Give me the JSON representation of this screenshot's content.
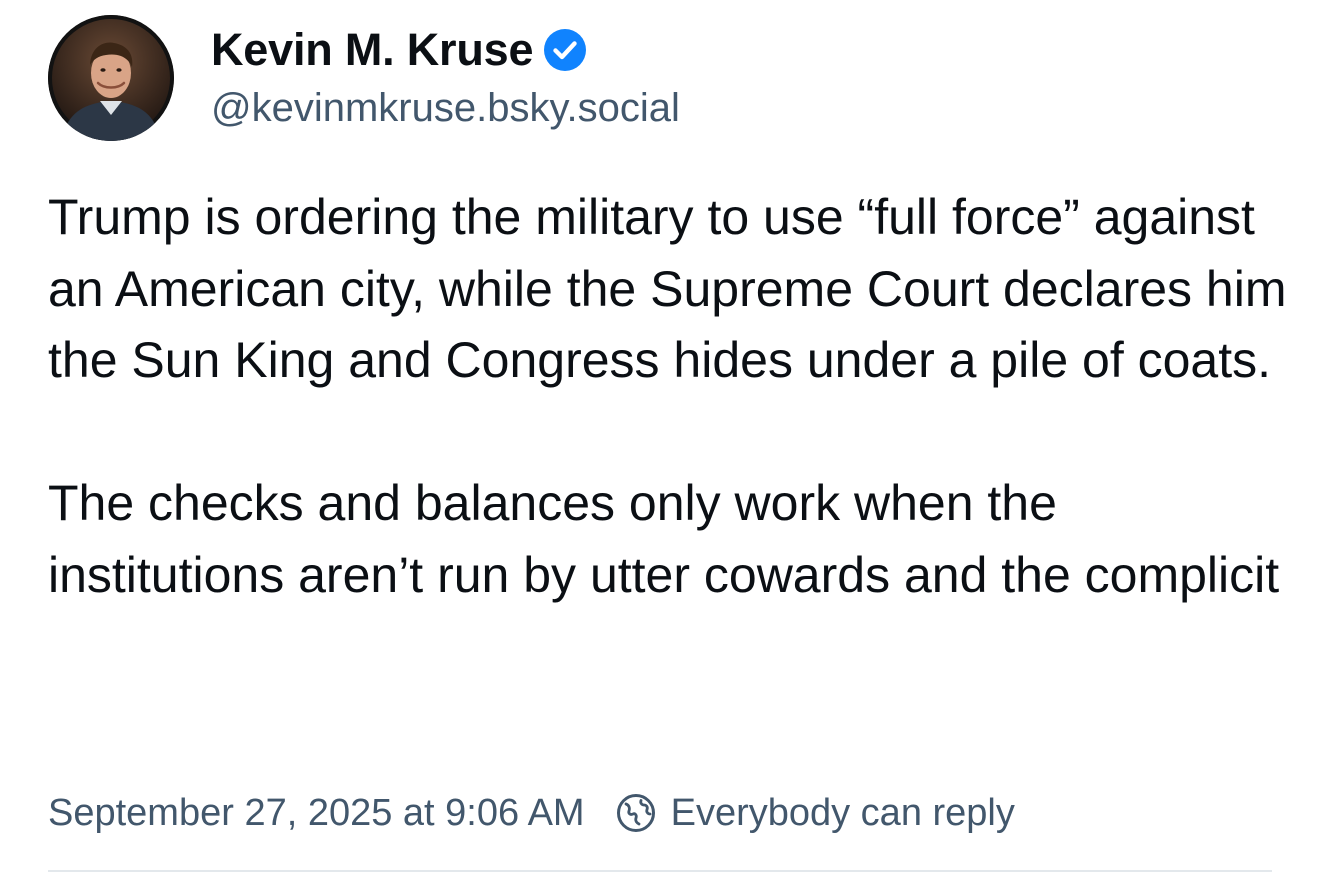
{
  "author": {
    "display_name": "Kevin M. Kruse",
    "handle": "@kevinmkruse.bsky.social",
    "verified": true,
    "verified_color": "#1083fe"
  },
  "post": {
    "paragraphs": [
      "Trump is ordering the military to use “full force” against an American city, while the Supreme Court declares him the Sun King and Congress hides under a pile of coats.",
      "The checks and balances only work when the institutions aren’t run by utter cowards and the complicit"
    ]
  },
  "meta": {
    "timestamp": "September 27, 2025 at 9:06 AM",
    "reply_setting": "Everybody can reply",
    "reply_icon": "globe-icon"
  },
  "colors": {
    "text_primary": "#0b0f14",
    "text_secondary": "#42576c",
    "divider": "#e3e8ec"
  }
}
